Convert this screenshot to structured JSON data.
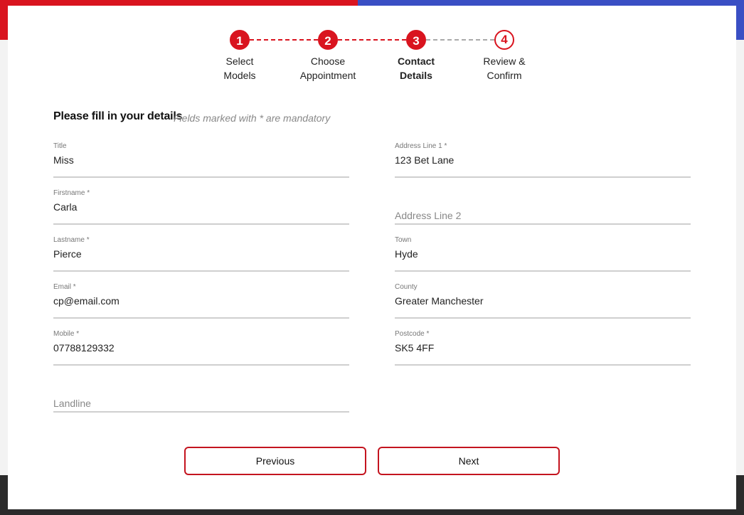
{
  "colors": {
    "accent": "#d9141f",
    "banner_left": "#d9141f",
    "banner_right": "#3a4fc4",
    "footer": "#2b2b2b"
  },
  "steps": [
    {
      "number": "1",
      "label": "Select\nModels",
      "state": "completed"
    },
    {
      "number": "2",
      "label": "Choose\nAppointment",
      "state": "completed"
    },
    {
      "number": "3",
      "label": "Contact\nDetails",
      "state": "current"
    },
    {
      "number": "4",
      "label": "Review &\nConfirm",
      "state": "upcoming"
    }
  ],
  "form": {
    "heading": "Please fill in your details",
    "note": "Fields marked with * are mandatory",
    "left": [
      {
        "label": "Title",
        "value": "Miss"
      },
      {
        "label": "Firstname *",
        "value": "Carla"
      },
      {
        "label": "Lastname *",
        "value": "Pierce"
      },
      {
        "label": "Email *",
        "value": "cp@email.com"
      },
      {
        "label": "Mobile *",
        "value": "07788129332"
      },
      {
        "placeholder": "Landline"
      }
    ],
    "right": [
      {
        "label": "Address Line 1 *",
        "value": "123 Bet Lane"
      },
      {
        "placeholder": "Address Line 2"
      },
      {
        "label": "Town",
        "value": "Hyde"
      },
      {
        "label": "County",
        "value": "Greater Manchester"
      },
      {
        "label": "Postcode *",
        "value": "SK5 4FF"
      }
    ]
  },
  "buttons": {
    "previous": "Previous",
    "next": "Next"
  }
}
